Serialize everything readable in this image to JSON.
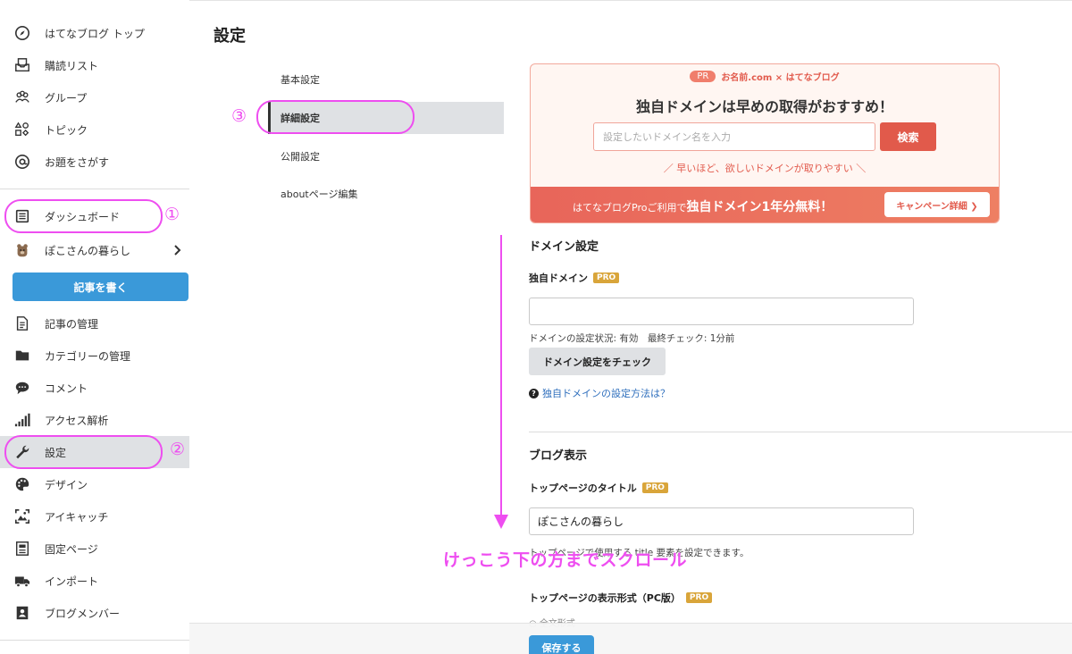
{
  "page_title": "設定",
  "sidebar": {
    "items": [
      {
        "label": "はてなブログ トップ",
        "icon": "compass-icon"
      },
      {
        "label": "購読リスト",
        "icon": "inbox-icon"
      },
      {
        "label": "グループ",
        "icon": "group-icon"
      },
      {
        "label": "トピック",
        "icon": "shapes-icon"
      },
      {
        "label": "お題をさがす",
        "icon": "at-icon"
      }
    ],
    "dashboard": {
      "label": "ダッシュボード",
      "icon": "list-icon"
    },
    "blog": {
      "label": "ぽこさんの暮らし",
      "icon": "bear-icon"
    },
    "write_button": "記事を書く",
    "manage_items": [
      {
        "label": "記事の管理",
        "icon": "document-icon"
      },
      {
        "label": "カテゴリーの管理",
        "icon": "folder-icon"
      },
      {
        "label": "コメント",
        "icon": "comment-icon"
      },
      {
        "label": "アクセス解析",
        "icon": "bars-icon"
      },
      {
        "label": "設定",
        "icon": "wrench-icon",
        "active": true
      },
      {
        "label": "デザイン",
        "icon": "palette-icon"
      },
      {
        "label": "アイキャッチ",
        "icon": "image-icon"
      },
      {
        "label": "固定ページ",
        "icon": "page-icon"
      },
      {
        "label": "インポート",
        "icon": "truck-icon"
      },
      {
        "label": "ブログメンバー",
        "icon": "member-icon"
      }
    ]
  },
  "annotations": {
    "n1": "①",
    "n2": "②",
    "n3": "③",
    "scroll": "けっこう下の方までスクロール"
  },
  "subnav": [
    {
      "label": "基本設定"
    },
    {
      "label": "詳細設定",
      "active": true
    },
    {
      "label": "公開設定"
    },
    {
      "label": "aboutページ編集"
    }
  ],
  "pr": {
    "badge": "PR",
    "head": "お名前.com × はてなブログ",
    "title": "独自ドメインは早めの取得がおすすめ！",
    "input_placeholder": "設定したいドメイン名を入力",
    "search": "検索",
    "note": "／ 早いほど、欲しいドメインが取りやすい ＼",
    "foot_prefix": "はてなブログProご利用で",
    "foot_bold": "独自ドメイン1年分無料！",
    "campaign": "キャンペーン詳細 ❯"
  },
  "domain": {
    "heading": "ドメイン設定",
    "label": "独自ドメイン",
    "pro": "PRO",
    "value": "",
    "status": "ドメインの設定状況: 有効　最終チェック: 1分前",
    "check_button": "ドメイン設定をチェック",
    "help_icon": "?",
    "help": "独自ドメインの設定方法は？"
  },
  "blog_display": {
    "heading": "ブログ表示",
    "title_label": "トップページのタイトル",
    "pro": "PRO",
    "title_value": "ぽこさんの暮らし",
    "title_hint": "トップページで使用する title 要素を設定できます。",
    "format_label": "トップページの表示形式（PC版）",
    "format_option": "○ 全文形式"
  },
  "save_button": "保存する",
  "colors": {
    "accent": "#3a99d9",
    "annotation": "#ee4ef0",
    "pr_red": "#e15a4b",
    "pro_badge": "#d9a53a"
  }
}
